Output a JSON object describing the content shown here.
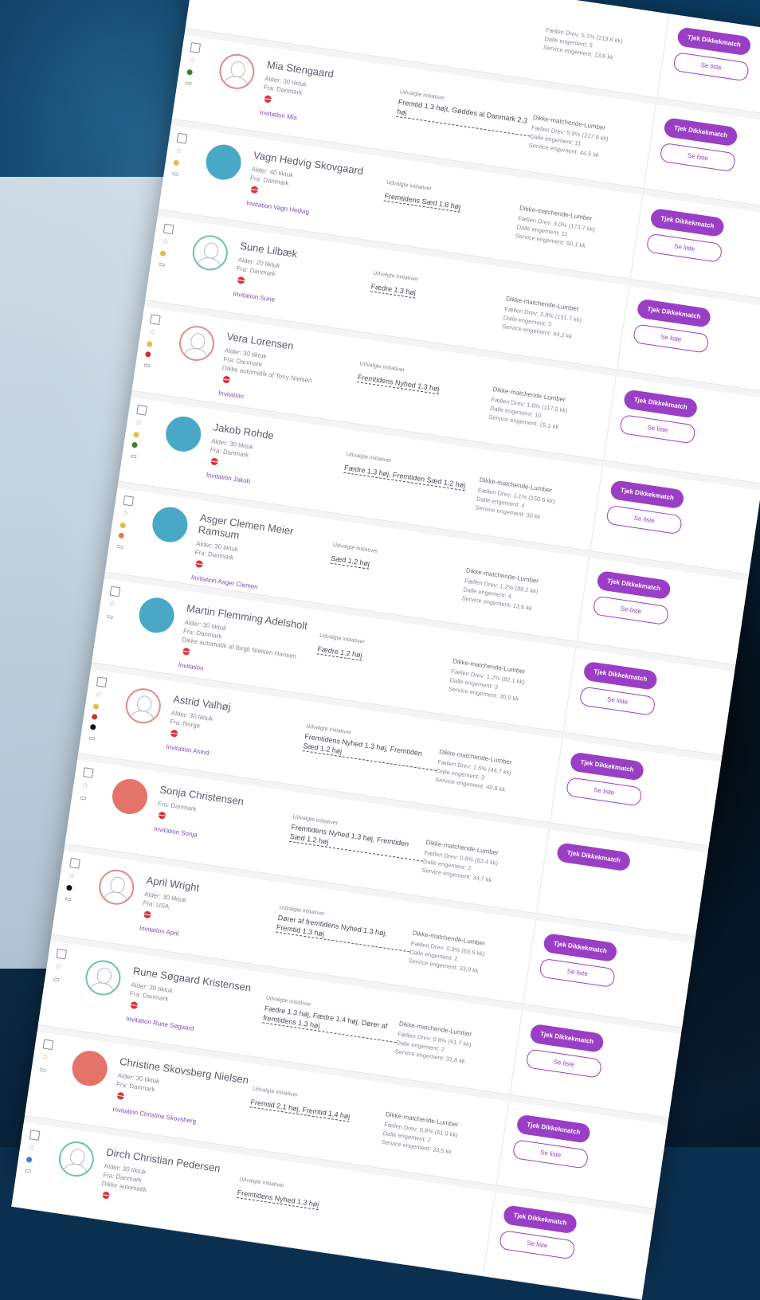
{
  "colors": {
    "accent": "#9b3ec6",
    "link": "#7b4fb8",
    "flag": "#d8333b"
  },
  "rows": [
    {
      "name": "",
      "avatar": "outline",
      "side_dots": [
        "#e0c040"
      ],
      "meta": "",
      "link": "",
      "label": "",
      "value": "",
      "stats_title": "",
      "stats": [
        "Fællen Drev: 5.1% (219.6 kk)",
        "Dalle engement: 5",
        "Service engement: 13,6 kk"
      ],
      "primary": "Tjek Dikkekmatch",
      "secondary": "Se liste"
    },
    {
      "name": "Mia Stengaard",
      "avatar": "outline",
      "side_dots": [
        "#3b7a3b"
      ],
      "meta": "Alder: 30 tiktuk\nFra: Danmark",
      "link": "Invitation Mia",
      "label": "Udvalgte initiativer",
      "value": "Fremtid 1.3 højt, Gøddes al Danmark 2.3 høj",
      "stats_title": "Dikke-matchende-Lumber",
      "stats": [
        "Fællen Drev: 5.8% (217.9 kk)",
        "Dalle engement: 11",
        "Service engement: 44,5 kk"
      ],
      "primary": "Tjek Dikkekmatch",
      "secondary": "Se liste"
    },
    {
      "name": "Vagn Hedvig Skovgaard",
      "avatar": "blue",
      "side_dots": [
        "#e0c040"
      ],
      "meta": "Alder: 40 tiktuk\nFra: Danmark",
      "link": "Invitation Vagn Hedvig",
      "label": "Udvalgte initiativer",
      "value": "Fremtidens Sæd 1.8 høj",
      "stats_title": "Dikke-matchende-Lumber",
      "stats": [
        "Fællen Drev: 3.0% (173.7 kk)",
        "Dalle engement: 11",
        "Service engement: 50,1 kk"
      ],
      "primary": "Tjek Dikkekmatch",
      "secondary": "Se liste"
    },
    {
      "name": "Sune Lilbæk",
      "avatar": "outline green",
      "side_dots": [
        "#e0c040"
      ],
      "meta": "Alder: 20 tiktuk\nFra: Danmark",
      "link": "Invitation Sune",
      "label": "Udvalgte initiativer",
      "value": "Fædre 1.3 høj",
      "stats_title": "Dikke-matchende-Lumber",
      "stats": [
        "Fællen Drev: 3.8% (151.7 kk)",
        "Dalle engement: 3",
        "Service engement: 44,2 kk"
      ],
      "primary": "Tjek Dikkekmatch",
      "secondary": "Se liste"
    },
    {
      "name": "Vera Lorensen",
      "avatar": "outline",
      "side_dots": [
        "#e0c040",
        "#c0392b"
      ],
      "meta": "Alder: 30 tiktuk\nFra: Danmark\nDikke automatik af Tony Nielsen",
      "link": "Invitation",
      "label": "Udvalgte initiativer",
      "value": "Fremtidens Nyhed 1.3 høj",
      "stats_title": "Dikke-matchende-Lumber",
      "stats": [
        "Fællen Drev: 1.6% (117.5 kk)",
        "Dalle engement: 10",
        "Service engement: 25,1 kk"
      ],
      "primary": "Tjek Dikkekmatch",
      "secondary": "Se liste"
    },
    {
      "name": "Jakob Rohde",
      "avatar": "blue",
      "side_dots": [
        "#e0c040",
        "#3b7a3b"
      ],
      "meta": "Alder: 30 tiktuk\nFra: Danmark",
      "link": "Invitation Jakob",
      "label": "Udvalgte initiativer",
      "value": "Fædre 1.3 høj, Fremtiden Sæd 1.2 høj",
      "stats_title": "Dikke-matchende-Lumber",
      "stats": [
        "Fællen Drev: 1.1% (150.6 kk)",
        "Dalle engement: 4",
        "Service engement: 30 kk"
      ],
      "primary": "Tjek Dikkekmatch",
      "secondary": "Se liste"
    },
    {
      "name": "Asger Clemen Meier Ramsum",
      "avatar": "blue",
      "side_dots": [
        "#e0c040",
        "#e08040"
      ],
      "meta": "Alder: 30 tiktuk\nFra: Danmark",
      "link": "Invitation Asger Clemen",
      "label": "Udvalgte initiativer",
      "value": "Sæd 1.2 høj",
      "stats_title": "Dikke-matchende-Lumber",
      "stats": [
        "Fællen Drev: 1.2% (88.2 kk)",
        "Dalle engement: 4",
        "Service engement: 13,6 kk"
      ],
      "primary": "Tjek Dikkekmatch",
      "secondary": "Se liste"
    },
    {
      "name": "Martin Flemming Adelsholt",
      "avatar": "blue",
      "side_dots": [],
      "meta": "Alder: 30 tiktuk\nFra: Danmark\nDikke automatik af Birgit Nielsen Hansen",
      "link": "Invitation",
      "label": "Udvalgte initiativer",
      "value": "Fædre 1.2 høj",
      "stats_title": "Dikke-matchende-Lumber",
      "stats": [
        "Fællen Drev: 1.2% (82.1 kk)",
        "Dalle engement: 3",
        "Service engement: 30,9 kk"
      ],
      "primary": "Tjek Dikkekmatch",
      "secondary": "Se liste"
    },
    {
      "name": "Astrid Valhøj",
      "avatar": "outline",
      "side_dots": [
        "#e0c040",
        "#c0392b",
        "#111111"
      ],
      "meta": "Alder: 30 tiktuk\nFra: Norge",
      "link": "Invitation Astrid",
      "label": "Udvalgte initiativer",
      "value": "Fremtidens Nyhed 1.3 høj, Fremtiden Sæd 1.2 høj",
      "stats_title": "Dikke-matchende-Lumber",
      "stats": [
        "Fællen Drev: 1.6% (44.7 kk)",
        "Dalle engement: 3",
        "Service engement: 40,8 kk"
      ],
      "primary": "Tjek Dikkekmatch",
      "secondary": "Se liste"
    },
    {
      "name": "Sonja Christensen",
      "avatar": "red",
      "side_dots": [],
      "meta": "Fra: Danmark",
      "link": "Invitation Sonja",
      "label": "Udvalgte initiativer",
      "value": "Fremtidens Nyhed 1.3 høj, Fremtiden Sæd 1.2 høj",
      "stats_title": "Dikke-matchende-Lumber",
      "stats": [
        "Fællen Drev: 0.8% (63.4 kk)",
        "Dalle engement: 2",
        "Service engement: 34,7 kk"
      ],
      "primary": "Tjek Dikkekmatch",
      "secondary": ""
    },
    {
      "name": "April Wright",
      "avatar": "outline",
      "side_dots": [
        "#111111"
      ],
      "meta": "Alder: 30 tiktuk\nFra: USA",
      "link": "Invitation April",
      "label": "Udvalgte initiativer",
      "value": "Dører af fremtidens Nyhed 1.3 høj, Fremtid 1.3 høj",
      "stats_title": "Dikke-matchende-Lumber",
      "stats": [
        "Fællen Drev: 0.8% (63.5 kk)",
        "Dalle engement: 2",
        "Service engement: 33,9 kk"
      ],
      "primary": "Tjek Dikkekmatch",
      "secondary": "Se liste"
    },
    {
      "name": "Rune Søgaard Kristensen",
      "avatar": "outline green",
      "side_dots": [],
      "meta": "Alder: 30 tiktuk\nFra: Danmark",
      "link": "Invitation Rune Søgaard",
      "label": "Udvalgte initiativer",
      "value": "Fædre 1.3 høj, Fædre 1.4 høj, Dører af fremtidens 1.3 høj",
      "stats_title": "Dikke-matchende-Lumber",
      "stats": [
        "Fællen Drev: 0.8% (61.7 kk)",
        "Dalle engement: 2",
        "Service engement: 31,8 kk"
      ],
      "primary": "Tjek Dikkekmatch",
      "secondary": "Se liste"
    },
    {
      "name": "Christine Skovsberg Nielsen",
      "avatar": "red",
      "side_dots": [],
      "meta": "Alder: 30 tiktuk\nFra: Danmark",
      "link": "Invitation Christine Skovsberg",
      "label": "Udvalgte initiativer",
      "value": "Fremtid 2.1 høj, Fremtid 1.4 høj",
      "stats_title": "Dikke-matchende-Lumber",
      "stats": [
        "Fællen Drev: 0.8% (61.9 kk)",
        "Dalle engement: 2",
        "Service engement: 33,5 kk"
      ],
      "primary": "Tjek Dikkekmatch",
      "secondary": "Se liste"
    },
    {
      "name": "Dirch Christian Pedersen",
      "avatar": "outline green",
      "side_dots": [
        "#3b7fd0"
      ],
      "meta": "Alder: 30 tiktuk\nFra: Danmark\nDikke automatik",
      "link": "",
      "label": "Udvalgte initiativer",
      "value": "Fremtidens Nyhed 1.3 høj",
      "stats_title": "",
      "stats": [],
      "primary": "Tjek Dikkekmatch",
      "secondary": "Se liste"
    }
  ]
}
